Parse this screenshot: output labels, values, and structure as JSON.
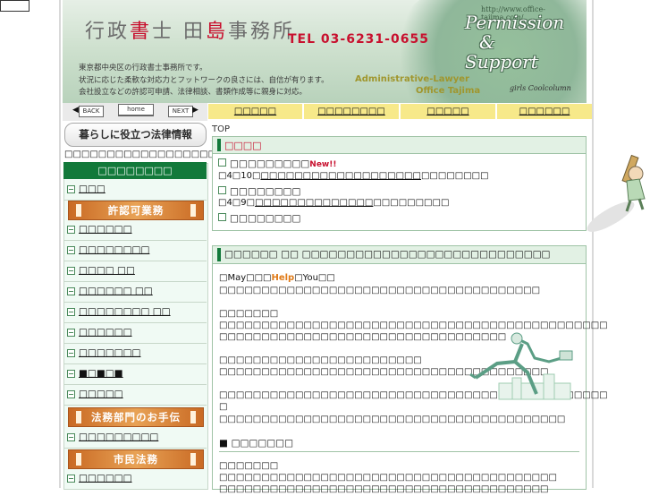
{
  "banner": {
    "url": "http://www.office-tajima.com/",
    "title_part1": "行政",
    "title_red": "書",
    "title_part2": "士 田",
    "title_red2": "島",
    "title_part3": "事務所",
    "tel": "TEL  03-6231-0655",
    "perm_line1": "Permission",
    "perm_line2": "&",
    "perm_line3": "Support",
    "desc_line1": "東京都中央区の行政書士事務所です。",
    "desc_line2": "状況に応じた柔軟な対応力とフットワークの良さには、自信が有ります。",
    "desc_line3": "会社設立などの許認可申請、法律相談、書類作成等に親身に対応。",
    "eng1": "Administrative-Lawyer",
    "eng2": "Office Tajima",
    "sig": "girls Coolcolumn"
  },
  "nav": {
    "back": "BACK",
    "home": "home",
    "next": "NEXT"
  },
  "tabs": [
    "□□□□□",
    "□□□□□□□□",
    "□□□□□",
    "□□□□□□"
  ],
  "sidebar": {
    "law_box": "暮らしに役立つ法律情報",
    "top_text": "□□□□□□□□□□□□□□□□□□□□",
    "head": "□□□□□□□□",
    "items": [
      "□□□",
      "□□□□□□",
      "□□□□□□□□",
      "□□□□ □□",
      "□□□□□□ □□",
      "□□□□□□□□ □□",
      "□□□□□□",
      "□□□□□□□",
      "■□■□■",
      "□□□□□",
      "□□□□□□□□□",
      "□□□□□□"
    ],
    "banner1": "許認可業務",
    "banner2": "法務部門のお手伝",
    "banner3": "市民法務"
  },
  "main": {
    "breadcrumb": "TOP",
    "news_head": "□□□□",
    "news": [
      {
        "title": "□□□□□□□□□",
        "badge": "New!!",
        "sub_pre": "□4□10□",
        "sub_link": "□□□□□□□□□□□□□□□□□□□",
        "sub_post": "□□□□□□□□"
      },
      {
        "title": "□□□□□□□□",
        "badge": "",
        "sub_pre": "□4□9□",
        "sub_link": "□□□□□□□□□□□□□□",
        "sub_post": "□□□□□□□□□"
      },
      {
        "title": "□□□□□□□□",
        "badge": "",
        "sub_pre": "",
        "sub_link": "",
        "sub_post": ""
      }
    ],
    "section_head": "□□□□□□ □□ □□□□□□□□□□□□□□□□□□□□□□□□□□□□",
    "greeting_pre": "□May□□□",
    "greeting_help": "Help",
    "greeting_post": "□You□□",
    "p1": "□□□□□□□□□□□□□□□□□□□□□□□□□□□□□□□□□□□□□□",
    "p2a": "□□□□□□□",
    "p2b": "□□□□□□□□□□□□□□□□□□□□□□□□□□□□□□□□□□□□□□□□□□□□□□",
    "p2c": "□□□□□□□□□□□□□□□□□□□□□□□□□□□□□□□□□□",
    "p3a": "□□□□□□□□□□□□□□□□□□□□□□□□",
    "p3b": "□□□□□□□□□□□□□□□□□□□□□□□□□□□□□□□□□□□□□□□",
    "p4a": "□□□□□□□□□□□□□□□□□□□□□□□□□□□□□□□□□□□□□□□□□□□□□□",
    "p4b": "□",
    "p4c": "□□□□□□□□□□□□□□□□□□□□□□□□□□□□□□□□□□□□□□□□□",
    "sub_head": "■ □□□□□□□",
    "p5a": "□□□□□□□",
    "p5b": "□□□□□□□□□□□□□□□□□□□□□□□□□□□□□□□□□□□□□□□□",
    "p5c": "□□□□□□□□□□□□□□□□□□□□□□□□□□□□□□□□□□□□□□□"
  }
}
